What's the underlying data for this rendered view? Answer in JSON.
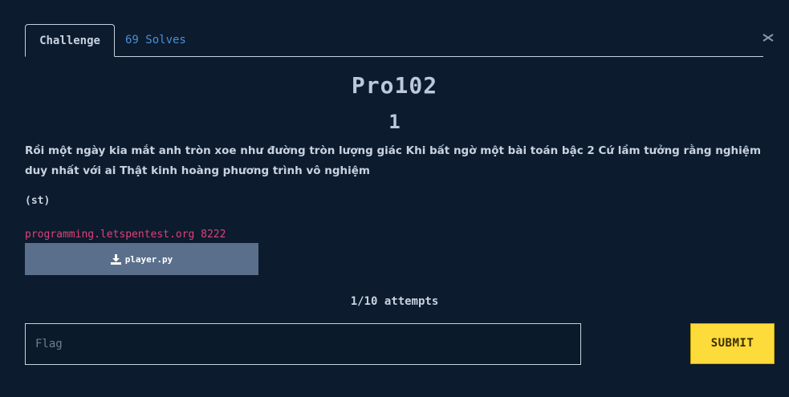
{
  "tabs": {
    "challenge_label": "Challenge",
    "solves_label": "69 Solves"
  },
  "challenge": {
    "name": "Pro102",
    "points": "1",
    "description": "Rồi một ngày kia mắt anh tròn xoe như đường tròn lượng giác Khi bất ngờ một bài toán bậc 2 Cứ lầm tưởng rằng nghiệm duy nhất với ai Thật kinh hoàng phương trình vô nghiệm",
    "author": "(st)",
    "connection": "programming.letspentest.org 8222",
    "file_label": "player.py",
    "attempts": "1/10 attempts"
  },
  "form": {
    "flag_placeholder": "Flag",
    "flag_value": "",
    "submit_label": "SUBMIT"
  },
  "icons": {
    "close": "close-icon",
    "download": "download-icon"
  },
  "colors": {
    "background": "#0c1b2d",
    "solves_link": "#4a8fd6",
    "connection_text": "#e0407a",
    "file_button": "#5a6f8c",
    "submit_button": "#fddb3a"
  }
}
